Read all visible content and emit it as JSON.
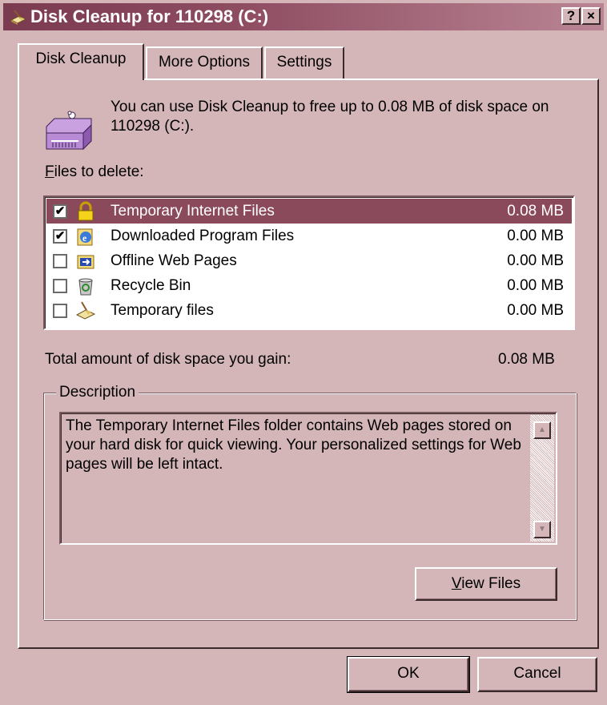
{
  "window": {
    "title": "Disk Cleanup for 110298 (C:)",
    "help_label": "?",
    "close_label": "×"
  },
  "tabs": [
    {
      "label": "Disk Cleanup",
      "selected": true
    },
    {
      "label": "More Options",
      "selected": false
    },
    {
      "label": "Settings",
      "selected": false
    }
  ],
  "intro": "You can use Disk Cleanup to free up to 0.08 MB of disk space on 110298 (C:).",
  "files_label": {
    "accel": "F",
    "rest": "iles to delete:"
  },
  "files": [
    {
      "name": "Temporary Internet Files",
      "size": "0.08 MB",
      "checked": true,
      "selected": true,
      "icon": "lock-icon"
    },
    {
      "name": "Downloaded Program Files",
      "size": "0.00 MB",
      "checked": true,
      "selected": false,
      "icon": "ie-icon"
    },
    {
      "name": "Offline Web Pages",
      "size": "0.00 MB",
      "checked": false,
      "selected": false,
      "icon": "offline-pages-icon"
    },
    {
      "name": "Recycle Bin",
      "size": "0.00 MB",
      "checked": false,
      "selected": false,
      "icon": "recycle-bin-icon"
    },
    {
      "name": "Temporary files",
      "size": "0.00 MB",
      "checked": false,
      "selected": false,
      "icon": "temp-files-icon"
    }
  ],
  "total": {
    "label": "Total amount of disk space you gain:",
    "value": "0.08 MB"
  },
  "description": {
    "label": "Description",
    "text": "The Temporary Internet Files folder contains Web pages stored on your hard disk for quick viewing. Your personalized settings for Web pages will be left intact."
  },
  "buttons": {
    "view_files": {
      "accel": "V",
      "rest": "iew Files"
    },
    "ok": "OK",
    "cancel": "Cancel"
  },
  "colors": {
    "face": "#d4b6b9",
    "title_active": "#7a3a4f",
    "selection": "#8b4a5c"
  }
}
